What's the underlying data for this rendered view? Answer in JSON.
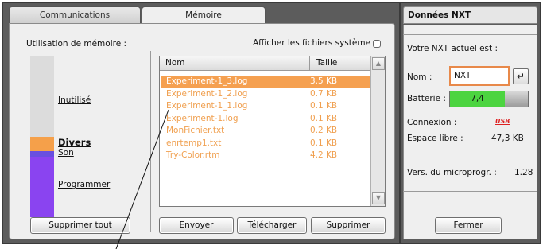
{
  "tabs": [
    {
      "label": "Communications",
      "active": false
    },
    {
      "label": "Mémoire",
      "active": true
    }
  ],
  "memory": {
    "title": "Utilisation de mémoire :",
    "segments": [
      {
        "label": "Inutilisé",
        "color": "#dcdcdc"
      },
      {
        "label": "Divers",
        "color": "#f5a04a"
      },
      {
        "label": "Son",
        "color": "#6a4fe0"
      },
      {
        "label": "Programmer",
        "color": "#8a44f0"
      }
    ],
    "delete_all_label": "Supprimer tout"
  },
  "files": {
    "show_system_label": "Afficher les fichiers système",
    "show_system_checked": false,
    "columns": [
      "Nom",
      "Taille"
    ],
    "rows": [
      {
        "name": "Experiment-1_3.log",
        "size": "3.5 KB",
        "selected": true
      },
      {
        "name": "Experiment-1_2.log",
        "size": "0.7 KB",
        "selected": false
      },
      {
        "name": "Experiment-1_1.log",
        "size": "0.1 KB",
        "selected": false
      },
      {
        "name": "Experiment-1.log",
        "size": "0.1 KB",
        "selected": false
      },
      {
        "name": "MonFichier.txt",
        "size": "0.2 KB",
        "selected": false
      },
      {
        "name": "enrtemp1.txt",
        "size": "0.1 KB",
        "selected": false
      },
      {
        "name": "Try-Color.rtm",
        "size": "4.2 KB",
        "selected": false
      }
    ],
    "buttons": {
      "send": "Envoyer",
      "download": "Télécharger",
      "delete": "Supprimer"
    }
  },
  "nxt": {
    "title": "Données NXT",
    "current_label": "Votre NXT actuel est :",
    "name_label": "Nom :",
    "name_value": "NXT",
    "battery_label": "Batterie :",
    "battery_value": "7,4",
    "battery_level": 0.7,
    "connection_label": "Connexion :",
    "connection_value": "USB",
    "free_label": "Espace libre :",
    "free_value": "47,3 KB",
    "firmware_label": "Vers. du microprogr. :",
    "firmware_value": "1.28",
    "close_label": "Fermer"
  },
  "colors": {
    "accent": "#f5a050",
    "battery": "#4cd440"
  }
}
